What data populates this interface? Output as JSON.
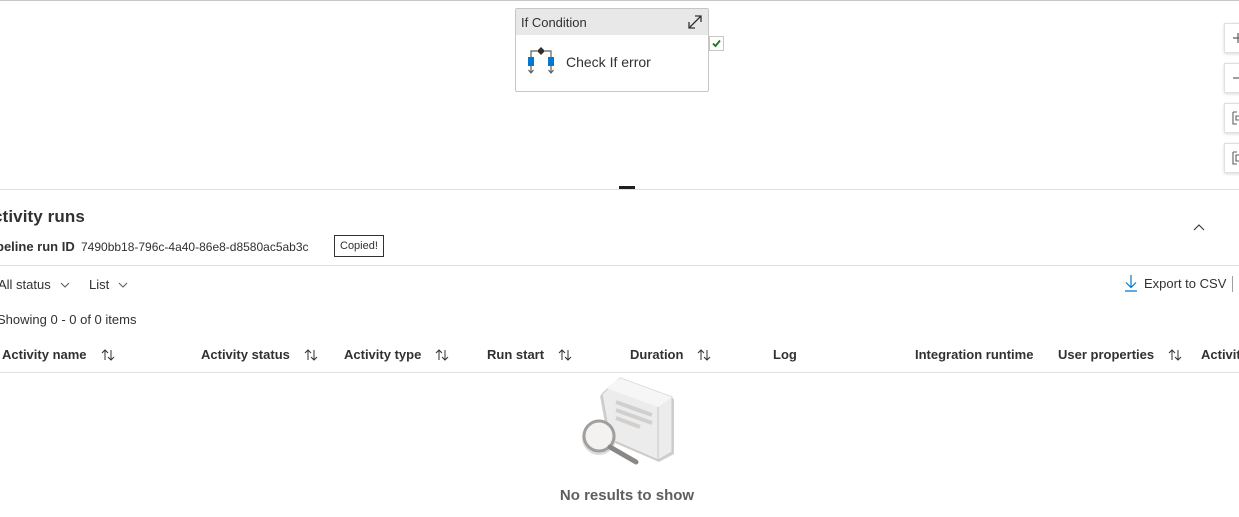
{
  "canvas": {
    "node": {
      "type_title": "If Condition",
      "name": "Check If error",
      "icons": {
        "expand": "expand-diagonal-icon",
        "activity": "if-condition-icon",
        "success": "success-check-icon"
      }
    },
    "toolbar_icons": [
      "zoom-in-icon",
      "zoom-out-icon",
      "zoom-to-fit-icon",
      "reset-zoom-icon"
    ]
  },
  "activity_runs": {
    "title": "ctivity runs",
    "pipeline_run_id_label": "peline run ID",
    "pipeline_run_id": "7490bb18-796c-4a40-86e8-d8580ac5ab3c",
    "copied_tooltip": "Copied!"
  },
  "filters": {
    "status": "All status",
    "view": "List"
  },
  "export_label": "Export to CSV",
  "item_count": "Showing 0 - 0 of 0 items",
  "table": {
    "columns": [
      {
        "label": "Activity name",
        "sortable": true
      },
      {
        "label": "Activity status",
        "sortable": true
      },
      {
        "label": "Activity type",
        "sortable": true
      },
      {
        "label": "Run start",
        "sortable": true
      },
      {
        "label": "Duration",
        "sortable": true
      },
      {
        "label": "Log",
        "sortable": false
      },
      {
        "label": "Integration runtime",
        "sortable": false
      },
      {
        "label": "User properties",
        "sortable": true
      },
      {
        "label": "Activit",
        "sortable": false
      }
    ],
    "rows": []
  },
  "empty_state": {
    "text": "No results to show",
    "icon": "no-results-illustration"
  },
  "colors": {
    "border": "#c8c6c4",
    "node_header": "#e8e8e8",
    "success_green": "#107c10",
    "activity_blue": "#0078d4",
    "text": "#323130"
  }
}
